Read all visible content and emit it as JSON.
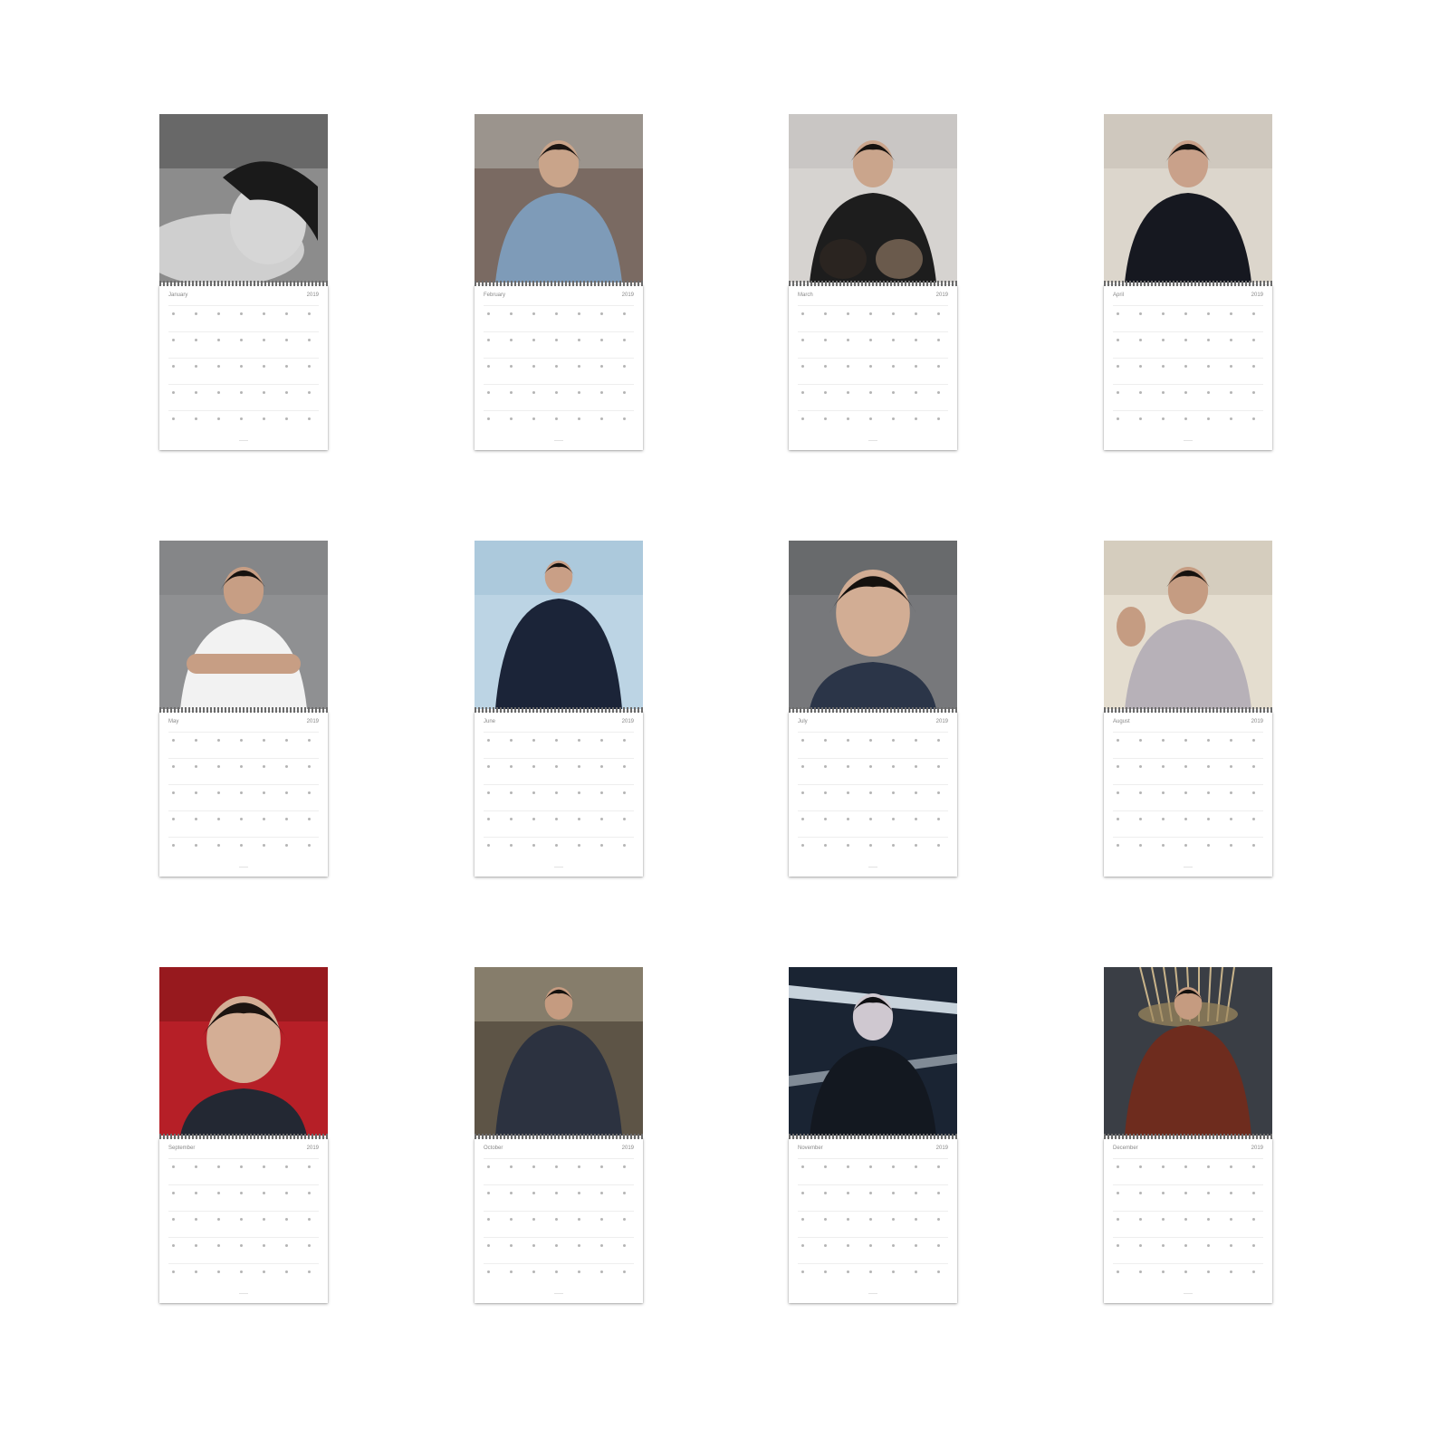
{
  "image_description": "",
  "calendar": {
    "year": "2019",
    "months": [
      {
        "label": "January",
        "photo": "bw-portrait-lying"
      },
      {
        "label": "February",
        "photo": "denim-jacket-portrait"
      },
      {
        "label": "March",
        "photo": "black-tshirt-with-dogs"
      },
      {
        "label": "April",
        "photo": "leather-jacket-portrait"
      },
      {
        "label": "May",
        "photo": "white-tank-arms-crossed"
      },
      {
        "label": "June",
        "photo": "navy-suit-portrait"
      },
      {
        "label": "July",
        "photo": "grin-with-food"
      },
      {
        "label": "August",
        "photo": "reaching-toward-camera"
      },
      {
        "label": "September",
        "photo": "red-background-closeup"
      },
      {
        "label": "October",
        "photo": "vest-in-hallway"
      },
      {
        "label": "November",
        "photo": "dark-lit-portrait"
      },
      {
        "label": "December",
        "photo": "chandelier-portrait"
      }
    ]
  }
}
